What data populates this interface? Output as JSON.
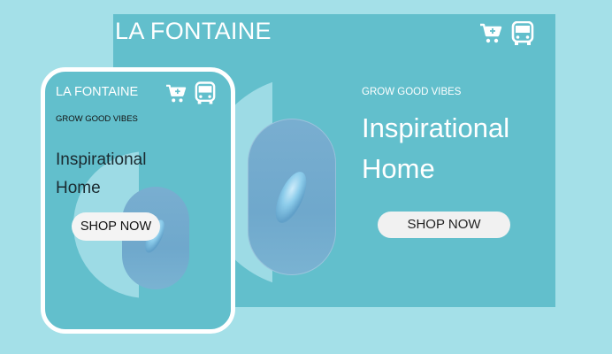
{
  "desktop": {
    "brand": "LA FONTAINE",
    "tagline": "GROW GOOD VIBES",
    "headline": "Inspirational Home",
    "cta_label": "SHOP NOW",
    "icons": [
      "cart-plus-icon",
      "bus-icon"
    ]
  },
  "mobile": {
    "brand": "LA FONTAINE",
    "tagline": "GROW GOOD VIBES",
    "headline": "Inspirational Home",
    "cta_label": "SHOP NOW",
    "icons": [
      "cart-plus-icon",
      "bus-icon"
    ]
  },
  "colors": {
    "background": "#a4e0e8",
    "hero": "#62bfcc",
    "circle": "#9ddbe5",
    "pill": "#6fa8cc",
    "button": "#f1f1f1"
  }
}
